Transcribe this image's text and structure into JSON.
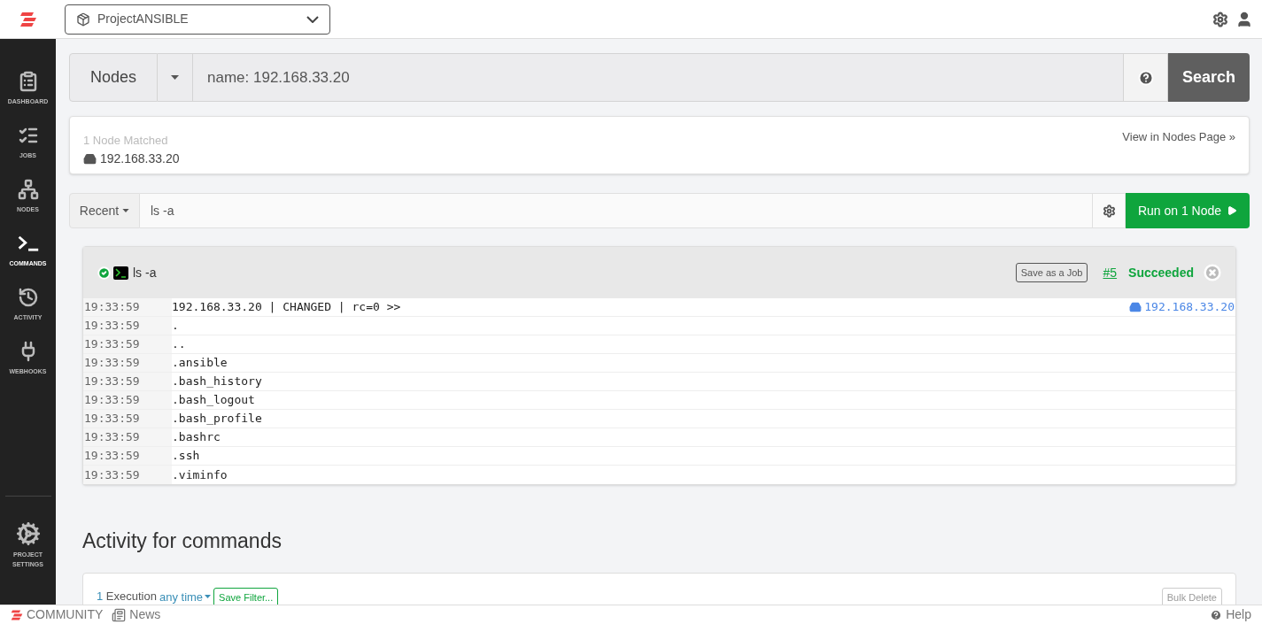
{
  "project_selector": {
    "value": "ProjectANSIBLE"
  },
  "sidebar": {
    "items": [
      {
        "label": "DASHBOARD",
        "kind": "dashboard",
        "selected": false
      },
      {
        "label": "JOBS",
        "kind": "jobs",
        "selected": false
      },
      {
        "label": "NODES",
        "kind": "nodes",
        "selected": false
      },
      {
        "label": "COMMANDS",
        "kind": "commands",
        "selected": true
      },
      {
        "label": "ACTIVITY",
        "kind": "activity",
        "selected": false
      },
      {
        "label": "WEBHOOKS",
        "kind": "webhooks",
        "selected": false
      }
    ],
    "bottom_item": {
      "label": "PROJECT SETTINGS"
    }
  },
  "node_search": {
    "type_button": "Nodes",
    "value": "name: 192.168.33.20",
    "search_button": "Search"
  },
  "node_match": {
    "count": "1 Node Matched",
    "node": "192.168.33.20",
    "link": "View in Nodes Page »"
  },
  "command_bar": {
    "recent": "Recent",
    "value": "ls -a",
    "run_button": "Run on 1 Node"
  },
  "output": {
    "command": "ls -a",
    "save_button": "Save as a Job",
    "execution_link": "#5",
    "status": "Succeeded",
    "node_link": "192.168.33.20",
    "rows": [
      {
        "time": "19:33:59",
        "text": "192.168.33.20 | CHANGED | rc=0 >>"
      },
      {
        "time": "19:33:59",
        "text": "."
      },
      {
        "time": "19:33:59",
        "text": ".."
      },
      {
        "time": "19:33:59",
        "text": ".ansible"
      },
      {
        "time": "19:33:59",
        "text": ".bash_history"
      },
      {
        "time": "19:33:59",
        "text": ".bash_logout"
      },
      {
        "time": "19:33:59",
        "text": ".bash_profile"
      },
      {
        "time": "19:33:59",
        "text": ".bashrc"
      },
      {
        "time": "19:33:59",
        "text": ".ssh"
      },
      {
        "time": "19:33:59",
        "text": ".viminfo"
      }
    ]
  },
  "activity": {
    "title": "Activity for commands",
    "count": "1",
    "count_label": "Execution",
    "time_filter": "any time",
    "save_filter": "Save Filter...",
    "bulk_delete": "Bulk Delete"
  },
  "footer": {
    "community": "COMMUNITY",
    "news": "News",
    "help": "Help"
  }
}
